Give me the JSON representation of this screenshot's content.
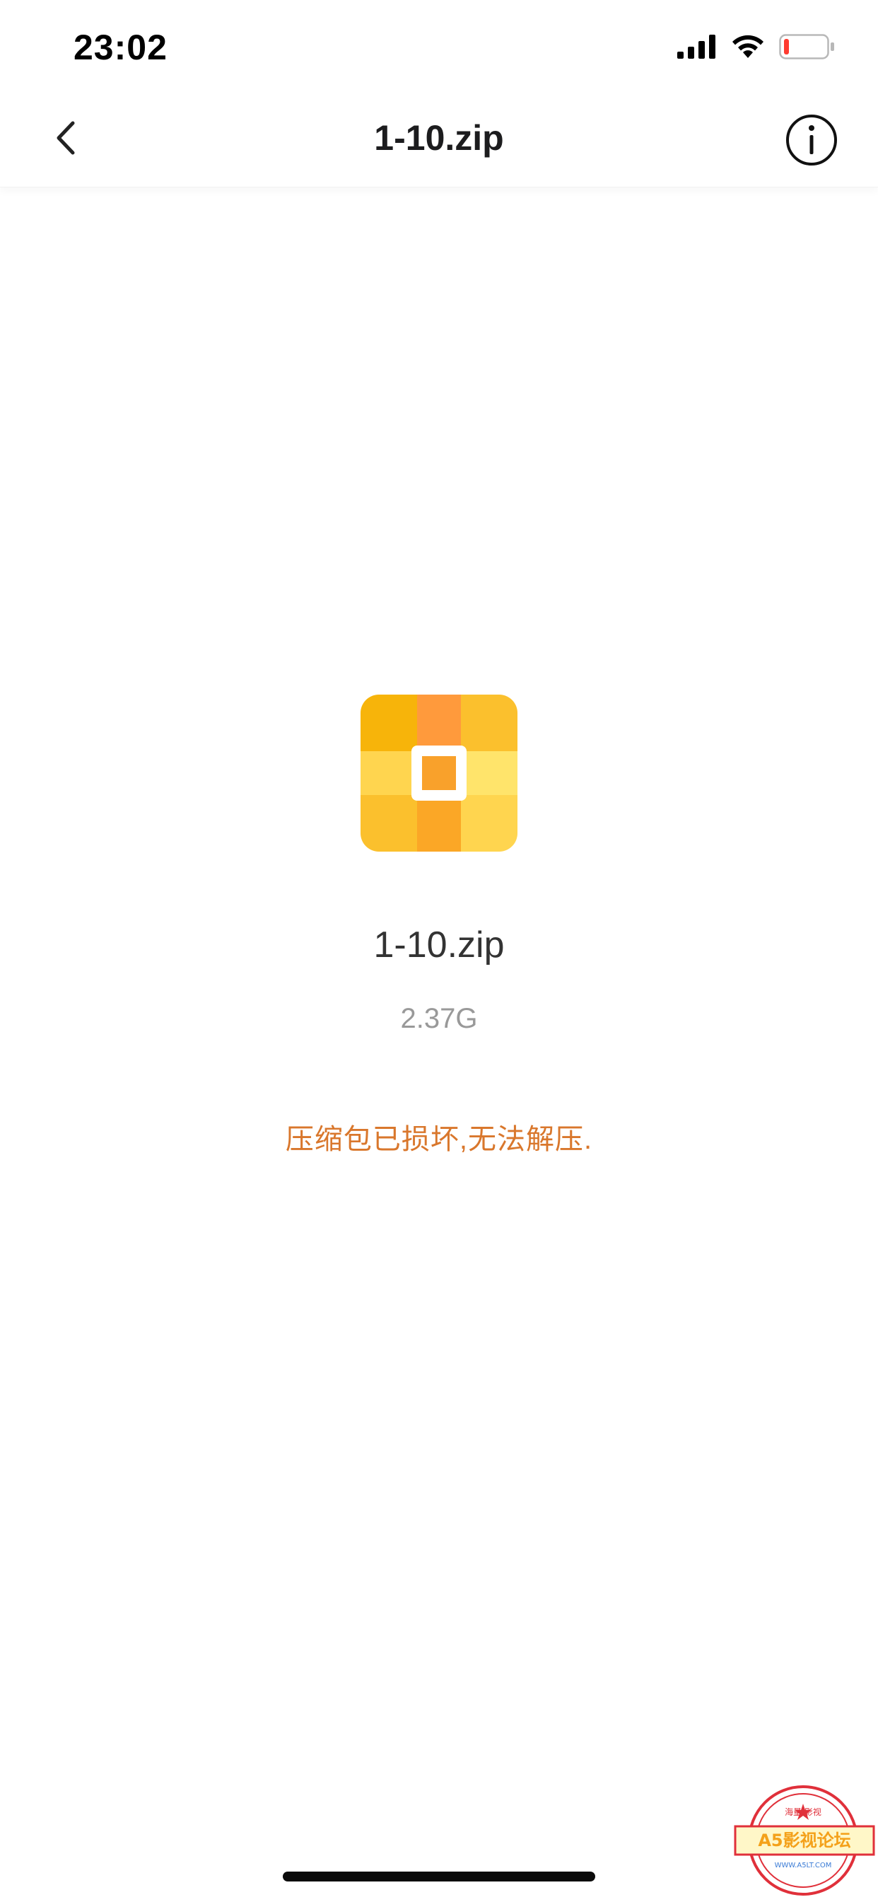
{
  "status_bar": {
    "time": "23:02",
    "icons": [
      "cellular-signal-icon",
      "wifi-icon",
      "battery-low-icon"
    ],
    "battery_color": "#ff3b30"
  },
  "nav": {
    "title": "1-10.zip",
    "back_icon": "chevron-left-icon",
    "info_icon": "info-circle-icon"
  },
  "file": {
    "icon": "zip-archive-icon",
    "icon_colors": [
      "#f7b40a",
      "#ff9a3c",
      "#fbc02d",
      "#ffd54f",
      "#ffe46b"
    ],
    "name": "1-10.zip",
    "size": "2.37G"
  },
  "error": {
    "message": "压缩包已损坏,无法解压.",
    "color": "#d9772c"
  },
  "watermark": {
    "top_text": "海量 影视",
    "main_text": "A5影视论坛",
    "url": "WWW.A5LT.COM"
  }
}
